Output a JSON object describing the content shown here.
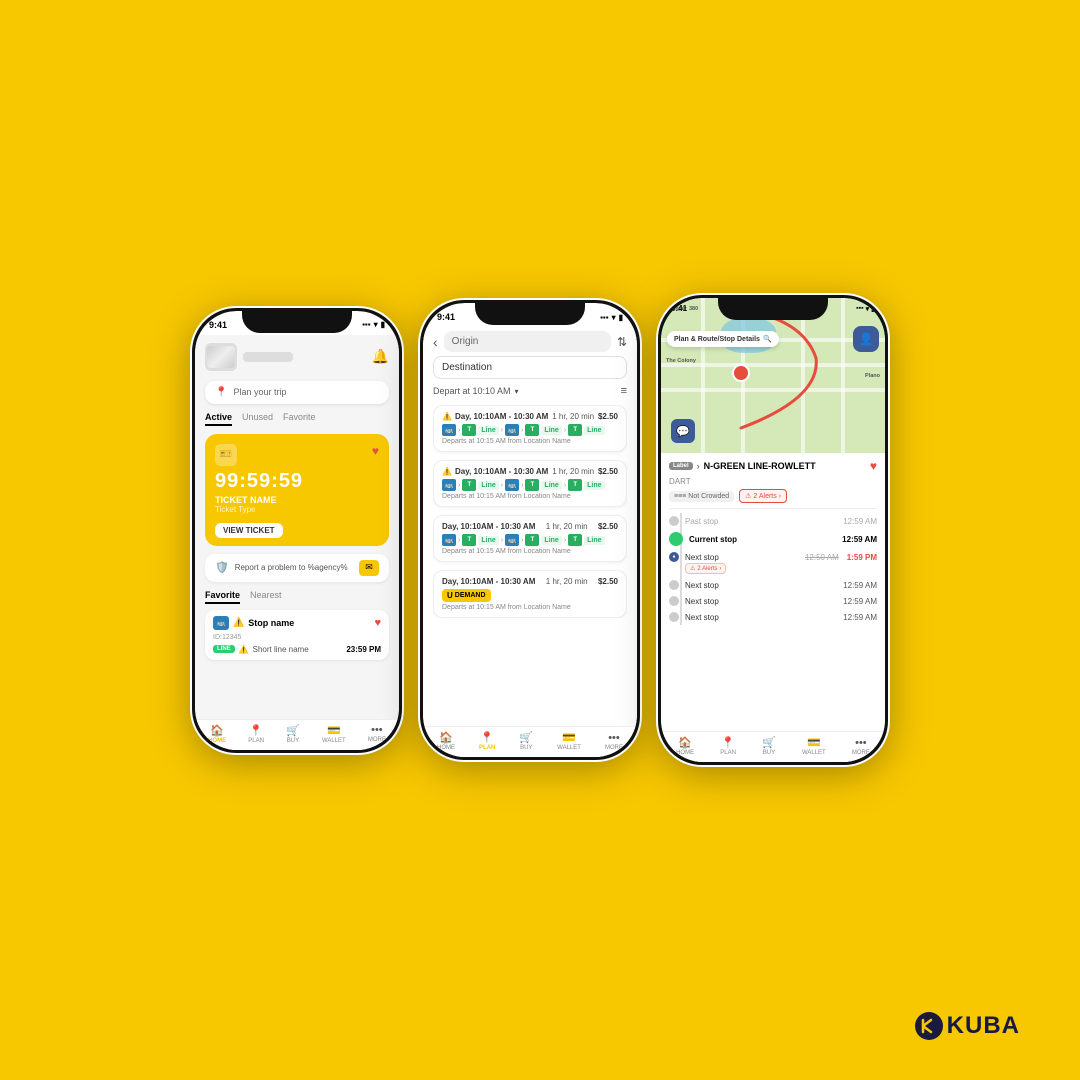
{
  "brand": {
    "name": "KUBA"
  },
  "phone1": {
    "status_time": "9:41",
    "plan_trip": "Plan your trip",
    "tabs": [
      "Active",
      "Unused",
      "Favorite"
    ],
    "active_tab": "Active",
    "timer": "99:59:59",
    "ticket_name": "TICKET NAME",
    "ticket_type": "Ticket Type",
    "view_ticket": "VIEW TICKET",
    "report_label": "Report a problem to %agency%",
    "favorite_tab": "Favorite",
    "nearest_tab": "Nearest",
    "stop_name": "Stop name",
    "stop_id": "ID:12345",
    "line_badge": "LINE",
    "line_name": "Short line name",
    "line_time": "23:59 PM",
    "nav": [
      "HOME",
      "PLAN",
      "BUY",
      "WALLET",
      "MORE"
    ]
  },
  "phone2": {
    "status_time": "9:41",
    "origin_label": "Origin",
    "destination_label": "Destination",
    "depart_label": "Depart at 10:10 AM",
    "trips": [
      {
        "time": "Day, 10:10AM - 10:30 AM",
        "duration": "1 hr, 20 min",
        "price": "$2.50",
        "departs": "Departs at 10:15 AM from Location Name",
        "type": "transit"
      },
      {
        "time": "Day, 10:10AM - 10:30 AM",
        "duration": "1 hr, 20 min",
        "price": "$2.50",
        "departs": "Departs at 10:15 AM from Location Name",
        "type": "transit"
      },
      {
        "time": "Day, 10:10AM - 10:30 AM",
        "duration": "1 hr, 20 min",
        "price": "$2.50",
        "departs": "Departs at 10:15 AM from Location Name",
        "type": "transit"
      },
      {
        "time": "Day, 10:10AM - 10:30 AM",
        "duration": "1 hr, 20 min",
        "price": "$2.50",
        "departs": "Departs at 10:15 AM from Location Name",
        "type": "demand"
      }
    ],
    "nav": [
      "HOME",
      "PLAN",
      "BUY",
      "WALLET",
      "MORE"
    ]
  },
  "phone3": {
    "status_time": "9:41",
    "map_header": "Plan & Route/Stop Details",
    "route_label": "Label",
    "route_name": "N-GREEN LINE-ROWLETT",
    "route_org": "DART",
    "not_crowded": "Not Crowded",
    "alerts_count": "2 Alerts",
    "stops": [
      {
        "name": "Past stop",
        "time": "12:59 AM",
        "type": "past"
      },
      {
        "name": "Current stop",
        "time": "12:59 AM",
        "type": "current"
      },
      {
        "name": "Next stop",
        "time": "12:59 AM",
        "type": "next",
        "struck_time": "12:50 AM",
        "real_time": "1:59 PM",
        "has_alerts": true
      },
      {
        "name": "Next stop",
        "time": "12:59 AM",
        "type": "next"
      },
      {
        "name": "Next stop",
        "time": "12:59 AM",
        "type": "next"
      },
      {
        "name": "Next stop",
        "time": "12:59 AM",
        "type": "next"
      }
    ],
    "nav": [
      "HOME",
      "PLAN",
      "BUY",
      "WALLET",
      "MORE"
    ]
  }
}
